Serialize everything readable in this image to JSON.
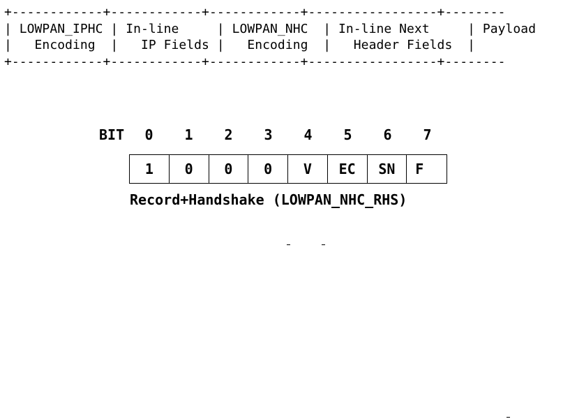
{
  "header_table": {
    "lines": [
      "+------------+------------+------------+-----------------+--------",
      "| LOWPAN_IPHC | In-line     | LOWPAN_NHC  | In-line Next     | Payload",
      "|   Encoding  |   IP Fields |   Encoding  |   Header Fields  |",
      "+------------+------------+------------+-----------------+--------"
    ]
  },
  "bit_diagram": {
    "label": "BIT",
    "bit_numbers": [
      "0",
      "1",
      "2",
      "3",
      "4",
      "5",
      "6",
      "7"
    ],
    "cells": [
      "1",
      "0",
      "0",
      "0",
      "V",
      "EC",
      "SN",
      "F"
    ],
    "caption": "Record+Handshake (LOWPAN_NHC_RHS)"
  }
}
